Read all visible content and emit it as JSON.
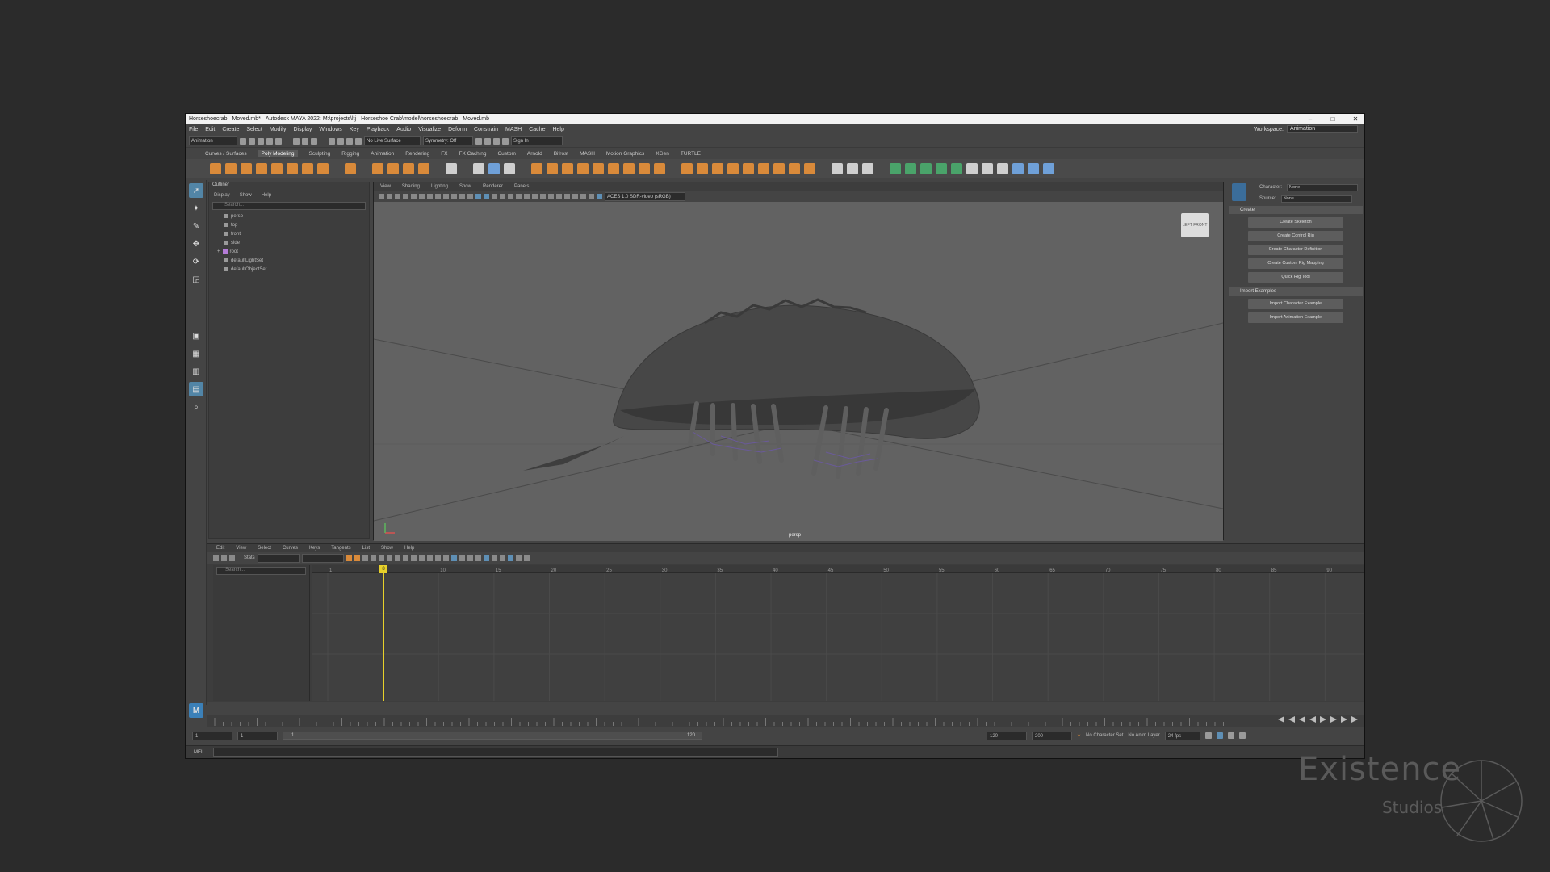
{
  "window": {
    "title_parts": [
      "Horseshoecrab",
      "Moved.mb*",
      "Autodesk MAYA 2022: M:\\projects\\ltj",
      "Horseshoe Crab\\model\\horseshoecrab",
      "Moved.mb"
    ],
    "controls": [
      "–",
      "□",
      "✕"
    ]
  },
  "menubar": {
    "items": [
      "File",
      "Edit",
      "Create",
      "Select",
      "Modify",
      "Display",
      "Windows",
      "Key",
      "Playback",
      "Audio",
      "Visualize",
      "Deform",
      "Constrain",
      "MASH",
      "Cache",
      "Help"
    ],
    "workspace_label": "Workspace:",
    "workspace_value": "Animation"
  },
  "statusline": {
    "menuset": "Animation",
    "live_surface": "No Live Surface",
    "symmetry": "Symmetry: Off",
    "login": "Sign In"
  },
  "shelf": {
    "tabs": [
      "Curves / Surfaces",
      "Poly Modeling",
      "Sculpting",
      "Rigging",
      "Animation",
      "Rendering",
      "FX",
      "FX Caching",
      "Custom",
      "Arnold",
      "Bifrost",
      "MASH",
      "Motion Graphics",
      "XGen",
      "TURTLE"
    ],
    "active_tab": "Poly Modeling"
  },
  "outliner": {
    "title": "Outliner",
    "menu": [
      "Display",
      "Show",
      "Help"
    ],
    "search_placeholder": "Search...",
    "items": [
      "persp",
      "top",
      "front",
      "side",
      "root",
      "defaultLightSet",
      "defaultObjectSet"
    ]
  },
  "viewport": {
    "menu": [
      "View",
      "Shading",
      "Lighting",
      "Show",
      "Renderer",
      "Panels"
    ],
    "colorspace": "ACES 1.0 SDR-video (sRGB)",
    "camera_label": "persp",
    "cube_labels": [
      "LEFT",
      "FRONT"
    ]
  },
  "attr_panel": {
    "character_label": "Character:",
    "character_value": "None",
    "source_label": "Source:",
    "source_value": "None",
    "section_create": "Create",
    "buttons_create": [
      "Create Skeleton",
      "Create Control Rig",
      "Create Character Definition",
      "Create Custom Rig Mapping",
      "Quick Rig Tool"
    ],
    "section_import": "Import Examples",
    "buttons_import": [
      "Import Character Example",
      "Import Animation Example"
    ]
  },
  "graph_editor": {
    "menu": [
      "Edit",
      "View",
      "Select",
      "Curves",
      "Keys",
      "Tangents",
      "List",
      "Show",
      "Help"
    ],
    "stats_label": "Stats",
    "search_placeholder": "Search...",
    "ruler_ticks": [
      "1",
      "5",
      "10",
      "15",
      "20",
      "25",
      "30",
      "35",
      "40",
      "45",
      "50",
      "55",
      "60",
      "65",
      "70",
      "75",
      "80",
      "85",
      "90"
    ],
    "current_frame": "8"
  },
  "range": {
    "start": "1",
    "start_inner": "1",
    "bar_left": "1",
    "bar_right": "120",
    "end_inner": "120",
    "end": "200",
    "no_character_set": "No Character Set",
    "no_anim_layer": "No Anim Layer",
    "fps": "24 fps"
  },
  "command_line": {
    "label": "MEL"
  },
  "branding": {
    "name": "Existence",
    "sub": "Studios"
  }
}
